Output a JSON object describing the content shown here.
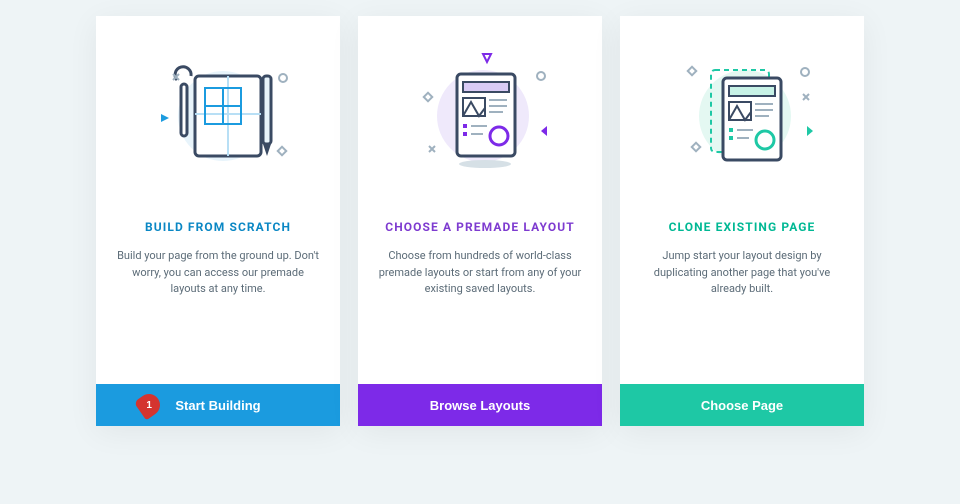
{
  "cards": [
    {
      "title": "BUILD FROM SCRATCH",
      "desc": "Build your page from the ground up. Don't worry, you can access our premade layouts at any time.",
      "button": "Start Building",
      "accent": "#1b9bdf"
    },
    {
      "title": "CHOOSE A PREMADE LAYOUT",
      "desc": "Choose from hundreds of world-class premade layouts or start from any of your existing saved layouts.",
      "button": "Browse Layouts",
      "accent": "#7d2ae8"
    },
    {
      "title": "CLONE EXISTING PAGE",
      "desc": "Jump start your layout design by duplicating another page that you've already built.",
      "button": "Choose Page",
      "accent": "#1ec8a5"
    }
  ],
  "step_marker": {
    "number": "1"
  }
}
